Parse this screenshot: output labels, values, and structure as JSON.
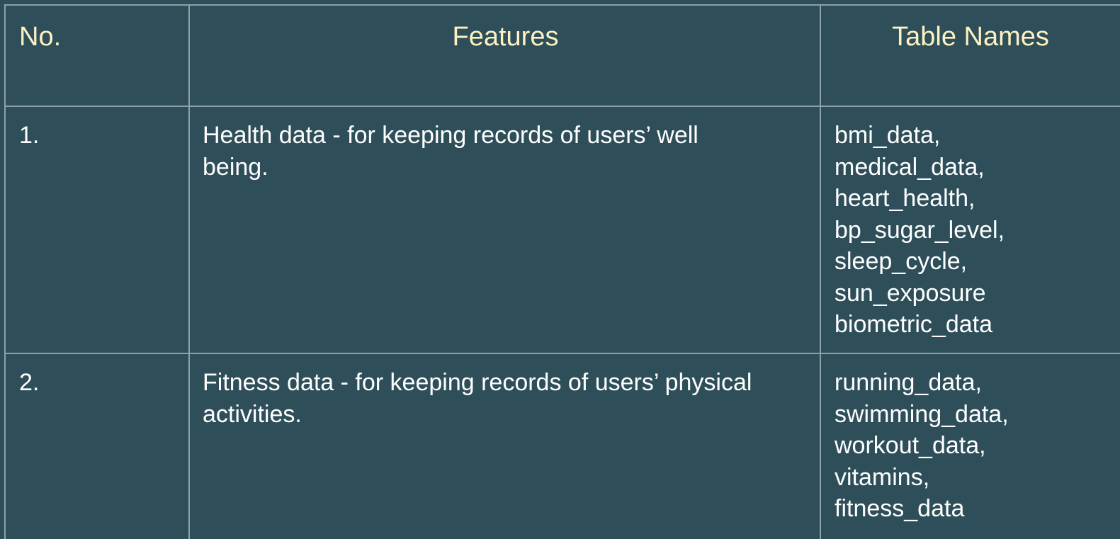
{
  "table": {
    "headers": {
      "no": "No.",
      "features": "Features",
      "table_names": "Table Names"
    },
    "rows": [
      {
        "no": "1.",
        "feature_line1": "Health data - for keeping records of users’ well",
        "feature_line2": "being.",
        "table_names": [
          "bmi_data,",
          "medical_data,",
          "heart_health,",
          "bp_sugar_level,",
          "sleep_cycle,",
          "sun_exposure",
          "biometric_data"
        ]
      },
      {
        "no": "2.",
        "feature_line1": "Fitness data - for keeping records of users’ physical",
        "feature_line2": "activities.",
        "table_names": [
          "running_data,",
          "swimming_data,",
          "workout_data,",
          "vitamins,",
          "fitness_data"
        ]
      }
    ]
  },
  "colors": {
    "background": "#2e4f59",
    "header_text": "#fdf1c3",
    "body_text": "#ffffff",
    "grid": "#8ea1a6"
  }
}
